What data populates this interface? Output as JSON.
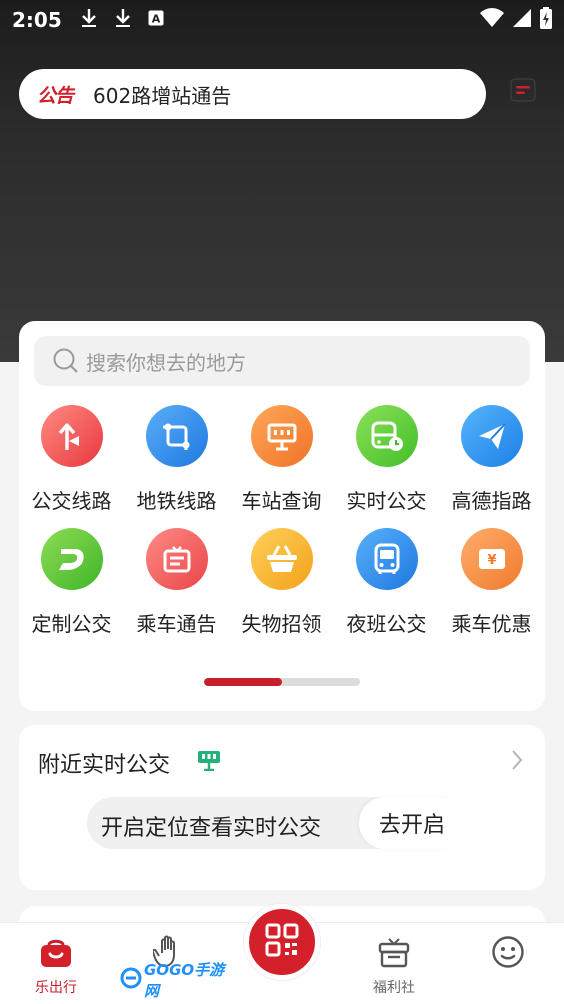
{
  "status_bar": {
    "time": "2:05"
  },
  "notice": {
    "tag": "公告",
    "text": "602路增站通告"
  },
  "search": {
    "placeholder": "搜索你想去的地方"
  },
  "services": [
    {
      "label": "公交线路",
      "icon": "route-arrow-icon",
      "color": "#f0555a"
    },
    {
      "label": "地铁线路",
      "icon": "subway-icon",
      "color": "#2f8ff0"
    },
    {
      "label": "车站查询",
      "icon": "station-sign-icon",
      "color": "#f38a3a"
    },
    {
      "label": "实时公交",
      "icon": "bus-clock-icon",
      "color": "#5ccf3a"
    },
    {
      "label": "高德指路",
      "icon": "paper-plane-icon",
      "color": "#2d95f2"
    },
    {
      "label": "定制公交",
      "icon": "custom-d-icon",
      "color": "#59c63a"
    },
    {
      "label": "乘车通告",
      "icon": "notice-board-icon",
      "color": "#f05f60"
    },
    {
      "label": "失物招领",
      "icon": "basket-icon",
      "color": "#f9b22c"
    },
    {
      "label": "夜班公交",
      "icon": "night-bus-icon",
      "color": "#2f8ff0"
    },
    {
      "label": "乘车优惠",
      "icon": "coupon-icon",
      "color": "#f58a3c"
    }
  ],
  "pager": {
    "current": 1,
    "total": 2
  },
  "nearby": {
    "title": "附近实时公交",
    "locate_text": "开启定位查看实时公交",
    "locate_button": "去开启"
  },
  "tabbar": {
    "tabs": [
      {
        "label": "乐出行",
        "icon": "home-bag-icon",
        "active": true
      },
      {
        "label": "",
        "icon": "hand-icon",
        "active": false
      },
      {
        "label": "福利社",
        "icon": "gift-box-icon",
        "active": false
      },
      {
        "label": "",
        "icon": "face-icon",
        "active": false
      }
    ],
    "center_icon": "qr-code-icon"
  },
  "watermark": {
    "text": "GOGO手游网"
  },
  "colors": {
    "brand_red": "#c8202a",
    "hero_dark": "#2b2b2b"
  }
}
